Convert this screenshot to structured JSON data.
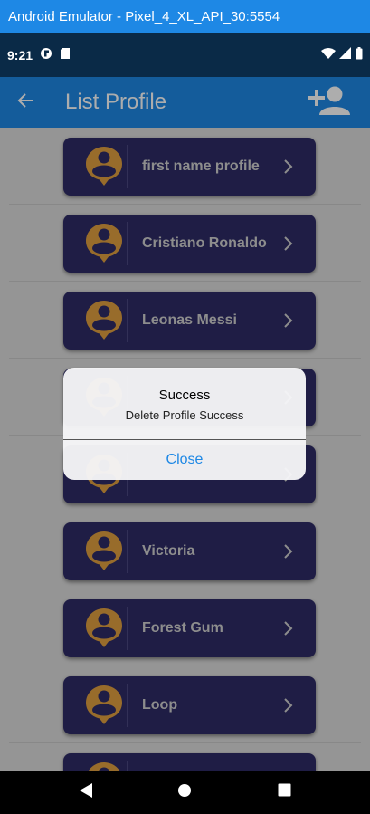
{
  "window": {
    "title": "Android Emulator - Pixel_4_XL_API_30:5554"
  },
  "status_bar": {
    "time": "9:21"
  },
  "app_bar": {
    "title": "List Profile",
    "back_icon": "arrow-back-icon",
    "add_icon": "person-add-icon"
  },
  "profiles": [
    {
      "name": "first name profile"
    },
    {
      "name": "Cristiano Ronaldo"
    },
    {
      "name": "Leonas Messi"
    },
    {
      "name": ""
    },
    {
      "name": ""
    },
    {
      "name": "Victoria"
    },
    {
      "name": "Forest Gum"
    },
    {
      "name": "Loop"
    },
    {
      "name": ""
    }
  ],
  "dialog": {
    "title": "Success",
    "message": "Delete Profile Success",
    "close_label": "Close"
  },
  "colors": {
    "primary": "#1e88e5",
    "card": "#2e2c66",
    "avatar": "#e0a040",
    "status_bar": "#0a2a47"
  }
}
